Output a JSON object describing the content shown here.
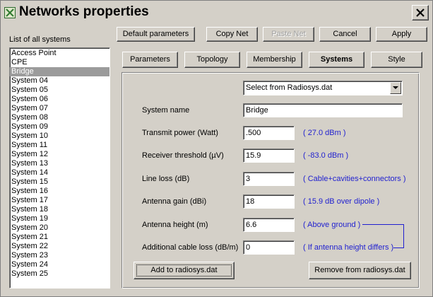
{
  "window": {
    "title": "Networks properties"
  },
  "left_panel": {
    "label": "List of all systems",
    "selected_index": 2,
    "items": [
      "Access Point",
      "CPE",
      "Bridge",
      "System 04",
      "System 05",
      "System 06",
      "System 07",
      "System 08",
      "System 09",
      "System 10",
      "System 11",
      "System 12",
      "System 13",
      "System 14",
      "System 15",
      "System 16",
      "System 17",
      "System 18",
      "System 19",
      "System 20",
      "System 21",
      "System 22",
      "System 23",
      "System 24",
      "System 25"
    ]
  },
  "toolbar": {
    "default_parameters": "Default parameters",
    "copy_net": "Copy Net",
    "paste_net": "Paste Net",
    "cancel": "Cancel",
    "apply": "Apply"
  },
  "tabs": {
    "parameters": "Parameters",
    "topology": "Topology",
    "membership": "Membership",
    "systems": "Systems",
    "style": "Style",
    "active": "systems"
  },
  "systems": {
    "select_value": "Select from Radiosys.dat",
    "system_name_label": "System name",
    "system_name_value": "Bridge",
    "transmit_power_label": "Transmit power (Watt)",
    "transmit_power_value": ".500",
    "transmit_power_hint": "( 27.0 dBm )",
    "receiver_threshold_label": "Receiver threshold (µV)",
    "receiver_threshold_value": "15.9",
    "receiver_threshold_hint": "( -83.0 dBm )",
    "line_loss_label": "Line loss (dB)",
    "line_loss_value": "3",
    "line_loss_hint": "( Cable+cavities+connectors )",
    "antenna_gain_label": "Antenna gain (dBi)",
    "antenna_gain_value": "18",
    "antenna_gain_hint": "( 15.9 dB over dipole )",
    "antenna_height_label": "Antenna height (m)",
    "antenna_height_value": "6.6",
    "antenna_height_hint": "( Above ground )",
    "additional_cable_loss_label": "Additional cable loss (dB/m)",
    "additional_cable_loss_value": "0",
    "additional_cable_loss_hint": "( If antenna height differs )",
    "add_button": "Add to radiosys.dat",
    "remove_button": "Remove from radiosys.dat"
  },
  "colors": {
    "hint_blue": "#1f1fd0",
    "selection": "#9b9b9b",
    "face": "#d4d0c8"
  }
}
